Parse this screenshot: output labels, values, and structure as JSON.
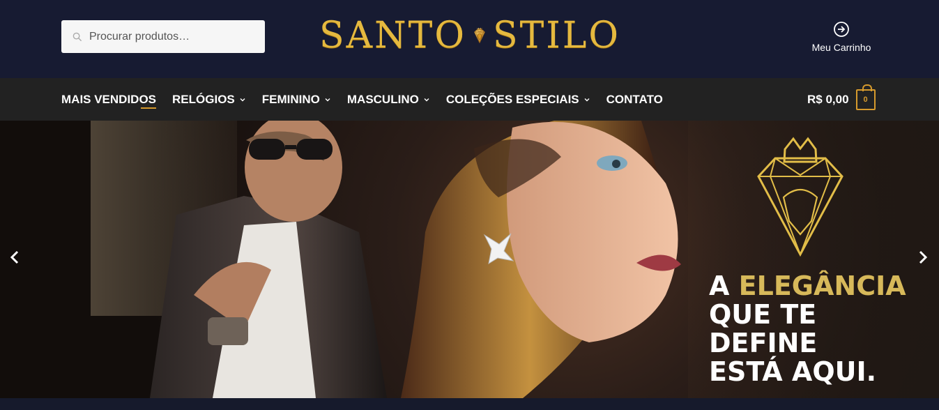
{
  "search": {
    "placeholder": "Procurar produtos…"
  },
  "brand": {
    "left": "SANTO",
    "right": "STILO"
  },
  "header_actions": {
    "cart_link_label": "Meu Carrinho"
  },
  "nav": {
    "items": [
      {
        "label": "MAIS VENDIDOS",
        "has_dropdown": false
      },
      {
        "label": "RELÓGIOS",
        "has_dropdown": true
      },
      {
        "label": "FEMININO",
        "has_dropdown": true
      },
      {
        "label": "MASCULINO",
        "has_dropdown": true
      },
      {
        "label": "COLEÇÕES ESPECIAIS",
        "has_dropdown": true
      },
      {
        "label": "CONTATO",
        "has_dropdown": false
      }
    ]
  },
  "cart": {
    "total": "R$ 0,00",
    "count": "0"
  },
  "hero": {
    "line1_white": "A",
    "line1_gold": "ELEGÂNCIA",
    "line2": "QUE TE DEFINE",
    "line3": "ESTÁ AQUI."
  },
  "colors": {
    "navy": "#171b32",
    "nav": "#222222",
    "gold": "#d69a2d",
    "logo_gold": "#e5b93f",
    "accent_gold": "#d7b95a"
  },
  "icons": [
    "search-icon",
    "cart-arrow-icon",
    "shopping-bag-icon",
    "chevron-down-icon",
    "chevron-left-icon",
    "chevron-right-icon",
    "lion-diamond-icon"
  ]
}
